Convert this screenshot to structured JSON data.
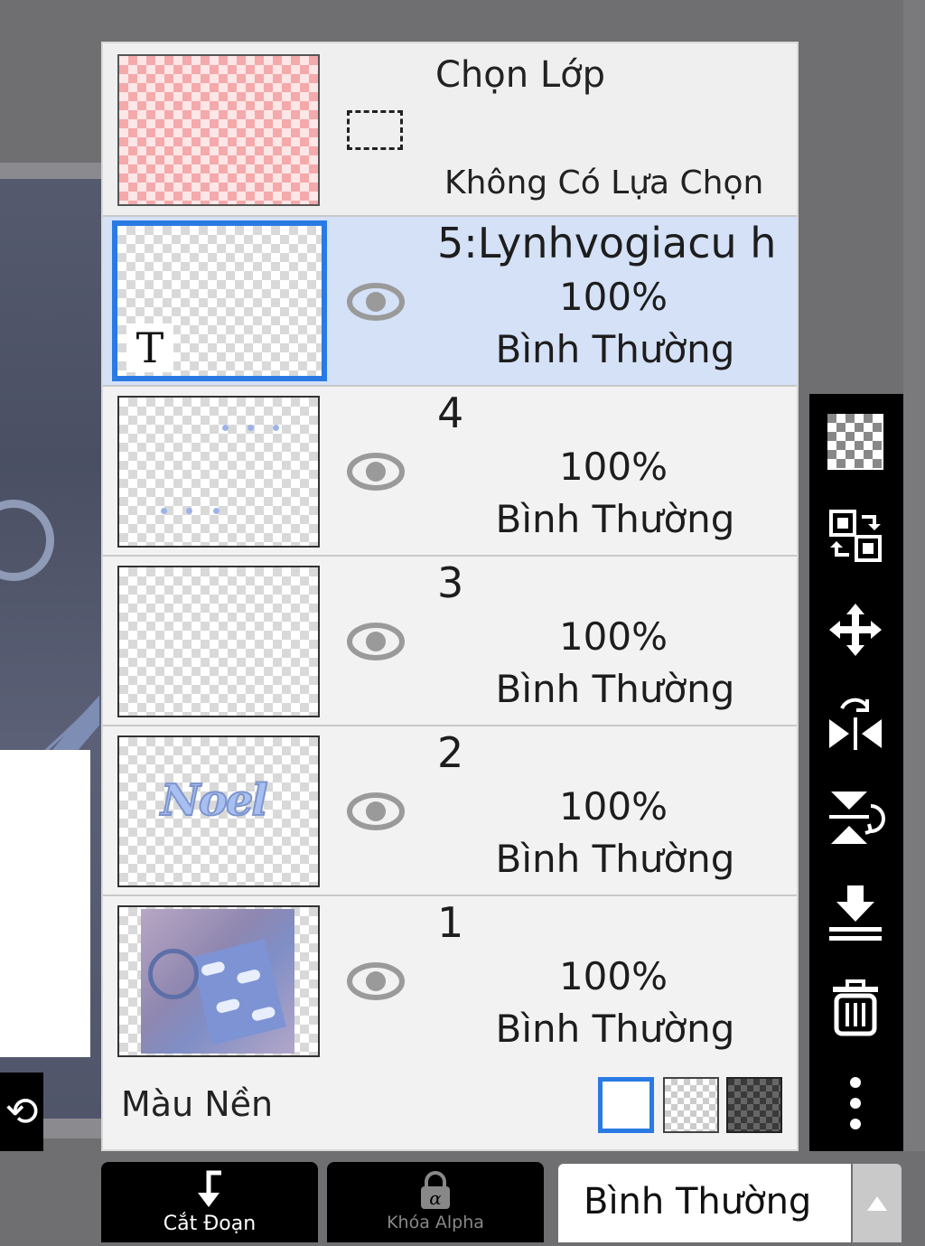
{
  "selection": {
    "title": "Chọn Lớp",
    "subtitle": "Không Có Lựa Chọn"
  },
  "layers": [
    {
      "name": "5:Lynhvogiacu h",
      "opacity": "100%",
      "blend": "Bình Thường",
      "selected": true,
      "thumb_badge": "T"
    },
    {
      "name": "4",
      "opacity": "100%",
      "blend": "Bình Thường",
      "selected": false
    },
    {
      "name": "3",
      "opacity": "100%",
      "blend": "Bình Thường",
      "selected": false
    },
    {
      "name": "2",
      "opacity": "100%",
      "blend": "Bình Thường",
      "selected": false,
      "thumb_text": "Noel"
    },
    {
      "name": "1",
      "opacity": "100%",
      "blend": "Bình Thường",
      "selected": false
    }
  ],
  "background": {
    "label": "Màu Nền",
    "options": [
      "white",
      "transparent",
      "dark-checker"
    ],
    "selected": "white"
  },
  "toolbar_icons": [
    "checker-icon",
    "swap-icon",
    "move-icon",
    "flip-horizontal-icon",
    "flip-vertical-icon",
    "merge-down-icon",
    "trash-icon",
    "more-icon"
  ],
  "bottom": {
    "clip_label": "Cắt Đoạn",
    "alpha_lock_label": "Khóa Alpha",
    "blend_mode": "Bình Thường"
  },
  "colors": {
    "accent": "#2a7ae4",
    "selected_row": "#d4e1f7"
  }
}
